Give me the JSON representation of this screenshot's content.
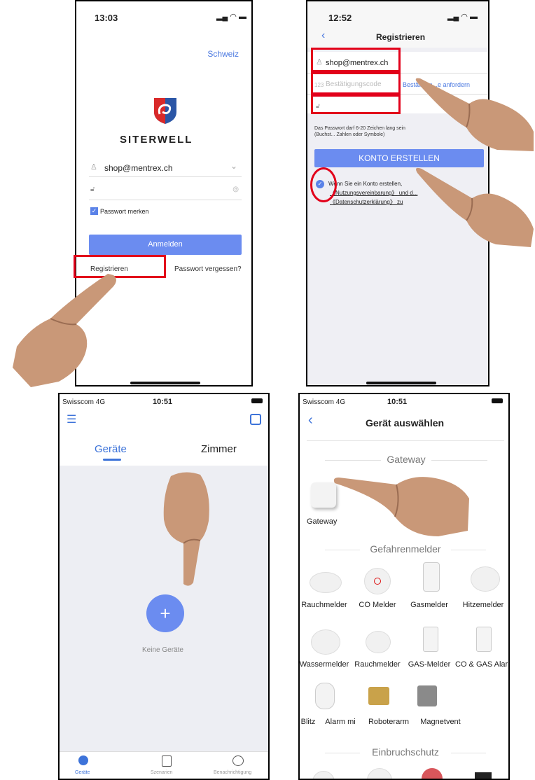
{
  "p1": {
    "time": "13:03",
    "region": "Schweiz",
    "brand": "SITERWELL",
    "email": "shop@mentrex.ch",
    "remember": "Passwort merken",
    "login": "Anmelden",
    "register": "Registrieren",
    "forgot": "Passwort vergessen?"
  },
  "p2": {
    "time": "12:52",
    "title": "Registrieren",
    "email": "shop@mentrex.ch",
    "code_placeholder": "Bestätigungscode",
    "code_button": "Bestätigun...e anfordern",
    "hint": "Das Passwort darf 6-20 Zeichen lang sein (Buchst... Zahlen oder Symbole)",
    "create": "KONTO ERSTELLEN",
    "agree1": "Wenn Sie ein Konto erstellen,",
    "agree2": "《Nutzungsvereinbarung》 und d...",
    "agree3": "《Datenschutzerklärung》 zu"
  },
  "p3": {
    "carrier": "Swisscom  4G",
    "time": "10:51",
    "tab_devices": "Geräte",
    "tab_rooms": "Zimmer",
    "empty": "Keine Geräte",
    "nav": [
      "Geräte",
      "Szenarien",
      "Benachrichtigung"
    ]
  },
  "p4": {
    "carrier": "Swisscom  4G",
    "time": "10:51",
    "title": "Gerät auswählen",
    "sec_gateway": "Gateway",
    "gateway": "Gateway",
    "sec_danger": "Gefahrenmelder",
    "row1": [
      "Rauchmelder",
      "CO Melder",
      "Gasmelder",
      "Hitzemelder"
    ],
    "row2": [
      "Wassermelder",
      "Rauchmelder",
      "GAS-Melder",
      "CO & GAS Alarm"
    ],
    "row3": [
      "Blitz",
      "Alarm mi",
      "Roboterarm",
      "Magnetvent"
    ],
    "sec_intrusion": "Einbruchschutz"
  },
  "colors": {
    "accent": "#6b8cf0",
    "red": "#e2001a",
    "tab": "#3d73d9"
  }
}
